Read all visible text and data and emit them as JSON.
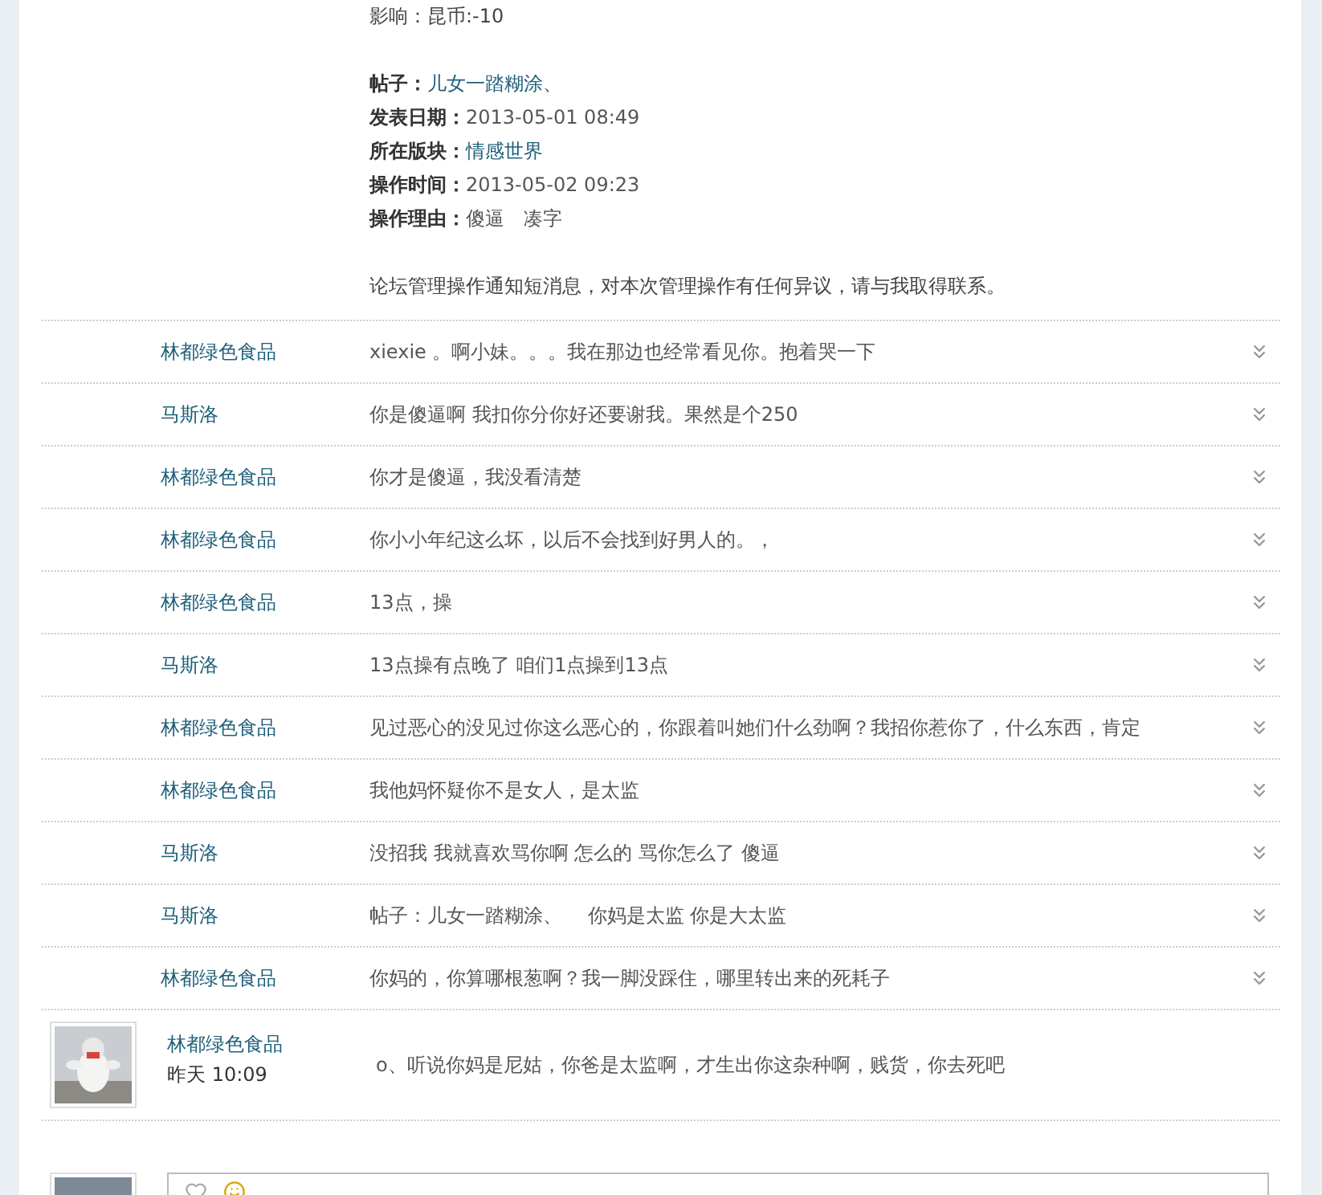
{
  "notice": {
    "impact": "影响：昆币:-10",
    "fields": [
      {
        "label": "帖子：",
        "value": "儿女一踏糊涂、",
        "kind": "link"
      },
      {
        "label": "发表日期：",
        "value": "2013-05-01 08:49",
        "kind": "text"
      },
      {
        "label": "所在版块：",
        "value": "情感世界",
        "kind": "link"
      },
      {
        "label": "操作时间：",
        "value": "2013-05-02 09:23",
        "kind": "text"
      },
      {
        "label": "操作理由：",
        "value": "傻逼　凑字",
        "kind": "text"
      }
    ],
    "footer": "论坛管理操作通知短消息，对本次管理操作有任何异议，请与我取得联系。"
  },
  "replies": [
    {
      "kind": "compact",
      "author": "林都绿色食品",
      "message": "xiexie 。啊小妹。。。我在那边也经常看见你。抱着哭一下"
    },
    {
      "kind": "compact",
      "author": "马斯洛",
      "message": "你是傻逼啊 我扣你分你好还要谢我。果然是个250"
    },
    {
      "kind": "compact",
      "author": "林都绿色食品",
      "message": "你才是傻逼，我没看清楚"
    },
    {
      "kind": "compact",
      "author": "林都绿色食品",
      "message": "你小小年纪这么坏，以后不会找到好男人的。，"
    },
    {
      "kind": "compact",
      "author": "林都绿色食品",
      "message": "13点，操"
    },
    {
      "kind": "compact",
      "author": "马斯洛",
      "message": "13点操有点晚了 咱们1点操到13点"
    },
    {
      "kind": "compact",
      "author": "林都绿色食品",
      "message": "见过恶心的没见过你这么恶心的，你跟着叫她们什么劲啊？我招你惹你了，什么东西，肯定"
    },
    {
      "kind": "compact",
      "author": "林都绿色食品",
      "message": "我他妈怀疑你不是女人，是太监"
    },
    {
      "kind": "compact",
      "author": "马斯洛",
      "message": "没招我 我就喜欢骂你啊  怎么的 骂你怎么了 傻逼"
    },
    {
      "kind": "compact",
      "author": "马斯洛",
      "message": "帖子：儿女一踏糊涂、　 你妈是太监  你是大太监"
    },
    {
      "kind": "compact",
      "author": "林都绿色食品",
      "message": "你妈的，你算哪根葱啊？我一脚没踩住，哪里转出来的死耗子"
    },
    {
      "kind": "full",
      "author": "林都绿色食品",
      "time": "昨天 10:09",
      "message": "o、听说你妈是尼姑，你爸是太监啊，才生出你这杂种啊，贱货，你去死吧"
    }
  ]
}
